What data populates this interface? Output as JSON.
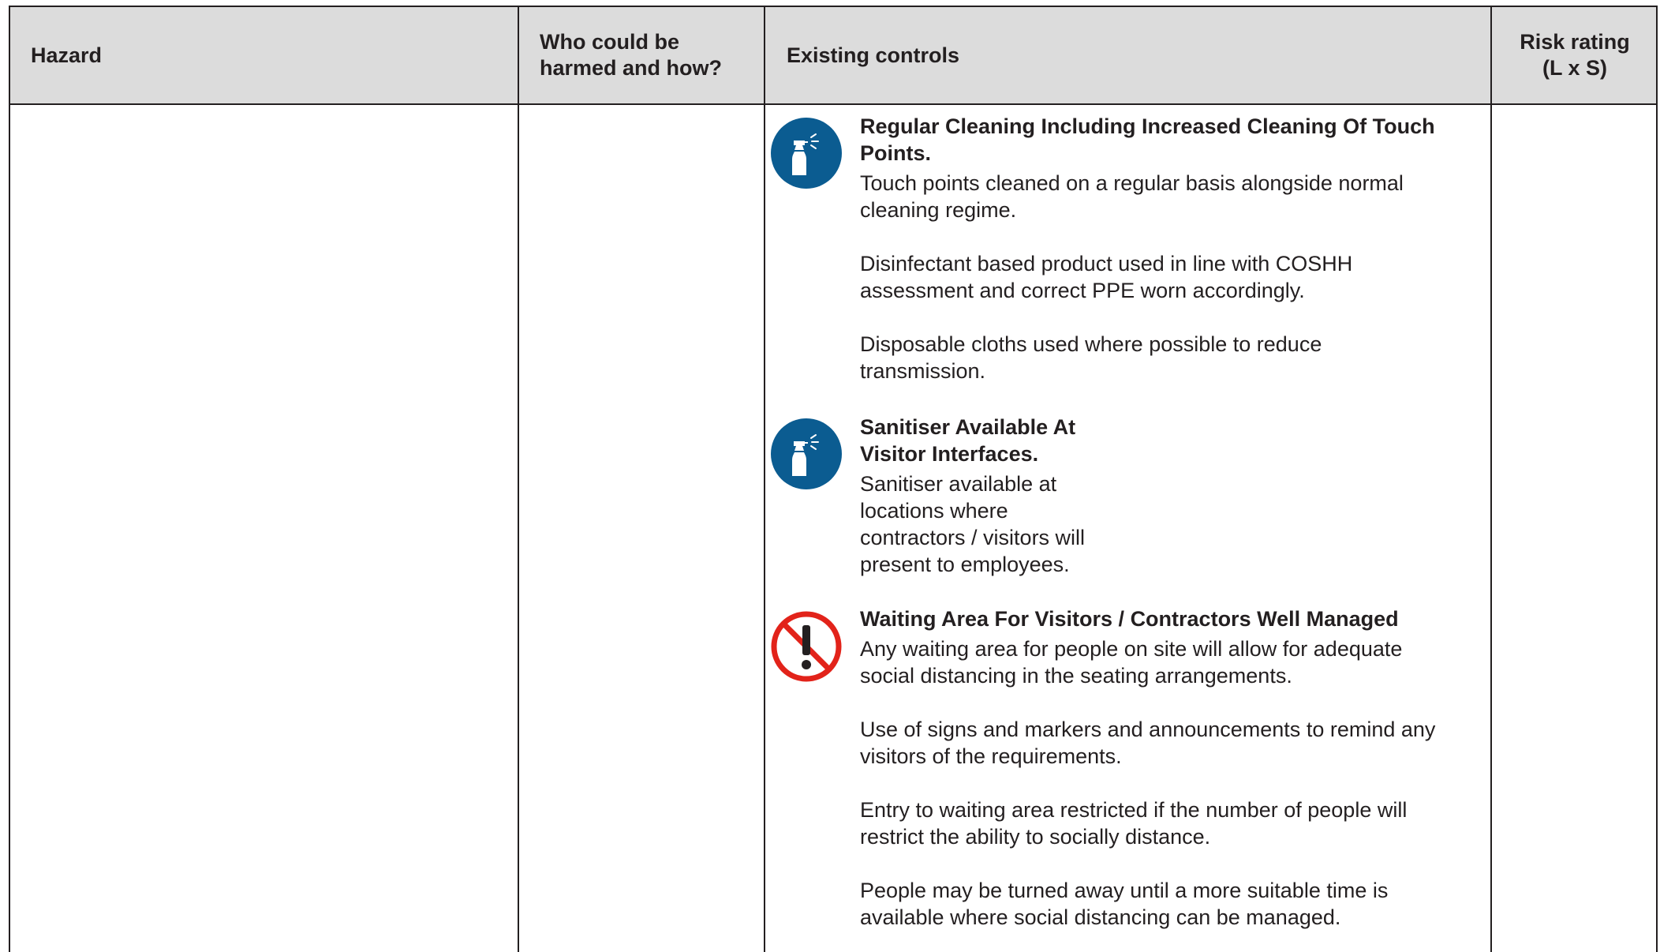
{
  "table": {
    "headers": {
      "hazard": "Hazard",
      "who_harmed": "Who could be\nharmed and how?",
      "existing_controls": "Existing controls",
      "risk_rating": "Risk rating\n(L x S)"
    }
  },
  "controls": [
    {
      "icon": "spray-bottle-icon",
      "title": "Regular Cleaning Including Increased Cleaning Of Touch\nPoints.",
      "paragraphs": [
        "Touch points cleaned on a regular basis alongside normal\ncleaning regime.",
        "Disinfectant based product used in line with COSHH\nassessment and correct PPE worn accordingly.",
        "Disposable cloths used where possible to reduce\ntransmission."
      ]
    },
    {
      "icon": "spray-bottle-icon",
      "title": "Sanitiser Available At\nVisitor Interfaces.",
      "paragraphs": [
        "Sanitiser available at\nlocations where\ncontractors / visitors will\npresent to employees."
      ]
    },
    {
      "icon": "no-exclamation-icon",
      "title": "Waiting Area For Visitors / Contractors Well Managed",
      "paragraphs": [
        "Any waiting area for people on site will allow for adequate\nsocial distancing in the seating arrangements.",
        "Use of signs and markers and announcements to remind any\nvisitors of the requirements.",
        "Entry to waiting area restricted if the number of people will\nrestrict the ability to socially distance.",
        "People may be turned away until a more suitable time is\navailable where social distancing can be managed."
      ]
    }
  ],
  "colors": {
    "header_bg": "#dcdcdc",
    "border": "#231f20",
    "icon_blue": "#0b5c91",
    "prohibition_red": "#e2231a"
  }
}
